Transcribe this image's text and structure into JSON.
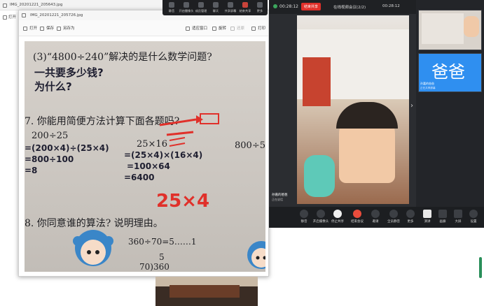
{
  "back_window": {
    "title": "IMG_20201221_205643.jpg",
    "open_label": "打开"
  },
  "front_window": {
    "title": "IMG_20201221_205726.jpg",
    "toolbar": {
      "open": "打开",
      "save": "保存",
      "save_as": "另存为",
      "fit_window": "适应窗口",
      "rotate": "旋转",
      "reset": "还原",
      "print": "打印"
    }
  },
  "photo": {
    "q3_line1": "(3)“4800÷240”解决的是什么数学问题?",
    "q3_answer1": "一共要多少钱?",
    "q3_answer2": "为什么?",
    "q7_heading": "7. 你能用简便方法计算下面各题吗?",
    "expr_1": "200÷25",
    "expr_2": "25×16",
    "expr_3": "800÷50",
    "work_1a": "=(200×4)÷(25×4)",
    "work_1b": "=800÷100",
    "work_1c": "=8",
    "work_2a": "=(25×4)×(16×4)",
    "work_2b": "=100×64",
    "work_2c": "=6400",
    "red_note": "25×4",
    "q8_heading": "8. 你同意谁的算法? 说明理由。",
    "q8_expr": "360÷70=5……1",
    "q8_quotient": "5",
    "q8_division": "70)360"
  },
  "meeting": {
    "timer": "00:28:12",
    "record_button": "结束共享",
    "meeting_title": "在线视频会议(2/2)",
    "meeting_timer": "00:28:12",
    "main_speaker": "孙嘉的爸爸",
    "main_speaker_sub": "正在说话",
    "participant_name": "孙嘉的爸爸",
    "participant_avatar_text": "爸爸",
    "participant_sub": "正在共享屏幕",
    "controls": [
      "静音",
      "开启摄像头",
      "停止共享",
      "结束会议",
      "邀请",
      "全员静音",
      "更多",
      "演讲",
      "画廊",
      "大屏",
      "设置"
    ]
  },
  "floating_toolbar": [
    "静音",
    "开启摄像头",
    "成员管理",
    "聊天",
    "共享屏幕",
    "结束共享",
    "更多"
  ],
  "colors": {
    "accent_red": "#e0302a",
    "avatar_blue": "#2f8ff0",
    "end_call": "#ea4c3c"
  }
}
